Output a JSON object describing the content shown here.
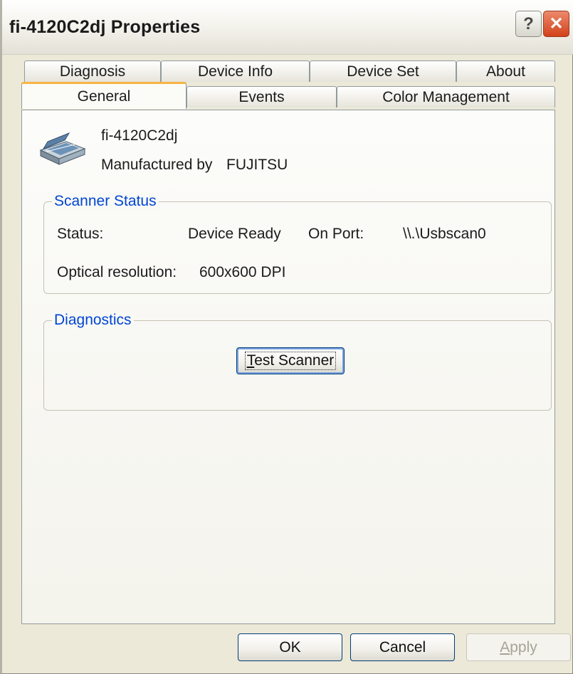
{
  "window": {
    "title": "fi-4120C2dj Properties",
    "help_label": "?",
    "close_label": "✕"
  },
  "tabs": {
    "row1": [
      "Diagnosis",
      "Device Info",
      "Device Set",
      "About"
    ],
    "row2": [
      "General",
      "Events",
      "Color Management"
    ],
    "active": "General"
  },
  "device": {
    "icon": "scanner-icon",
    "name": "fi-4120C2dj",
    "manufacturer_label": "Manufactured by",
    "manufacturer": "FUJITSU"
  },
  "scanner_status": {
    "title": "Scanner Status",
    "status_label": "Status:",
    "status_value": "Device Ready",
    "port_label": "On Port:",
    "port_value": "\\\\.\\Usbscan0",
    "resolution_label": "Optical resolution:",
    "resolution_value": "600x600 DPI"
  },
  "diagnostics": {
    "title": "Diagnostics",
    "test_button_first": "T",
    "test_button_rest": "est Scanner"
  },
  "footer": {
    "ok": "OK",
    "cancel": "Cancel",
    "apply_first": "A",
    "apply_rest": "pply"
  },
  "colors": {
    "accent": "#f7b544",
    "group_title": "#0046d5",
    "close_button": "#d2421b"
  }
}
